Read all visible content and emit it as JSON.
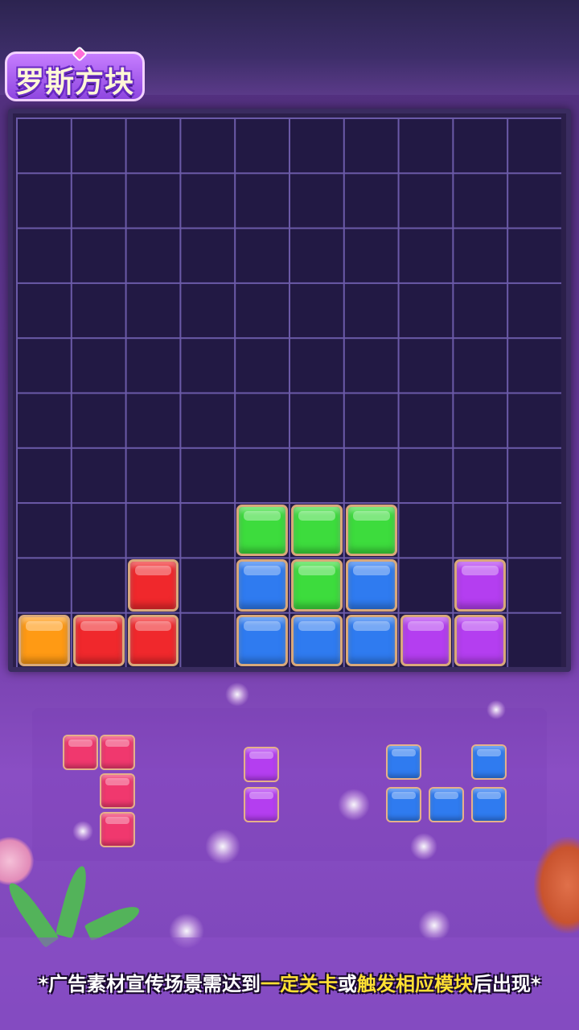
{
  "title": "罗斯方块",
  "board": {
    "columns": 10,
    "rows": 10,
    "filled_cells": [
      {
        "row": 7,
        "col": 4,
        "color": "green"
      },
      {
        "row": 7,
        "col": 5,
        "color": "green"
      },
      {
        "row": 7,
        "col": 6,
        "color": "green"
      },
      {
        "row": 8,
        "col": 2,
        "color": "red"
      },
      {
        "row": 8,
        "col": 4,
        "color": "blue"
      },
      {
        "row": 8,
        "col": 5,
        "color": "green"
      },
      {
        "row": 8,
        "col": 6,
        "color": "blue"
      },
      {
        "row": 8,
        "col": 8,
        "color": "purple"
      },
      {
        "row": 9,
        "col": 0,
        "color": "orange"
      },
      {
        "row": 9,
        "col": 1,
        "color": "red"
      },
      {
        "row": 9,
        "col": 2,
        "color": "red"
      },
      {
        "row": 9,
        "col": 4,
        "color": "blue"
      },
      {
        "row": 9,
        "col": 5,
        "color": "blue"
      },
      {
        "row": 9,
        "col": 6,
        "color": "blue"
      },
      {
        "row": 9,
        "col": 7,
        "color": "purple"
      },
      {
        "row": 9,
        "col": 8,
        "color": "purple"
      }
    ]
  },
  "pieces": [
    {
      "name": "piece-pink-j",
      "color": "pink",
      "cells": [
        [
          0,
          0
        ],
        [
          0,
          1
        ],
        [
          1,
          1
        ],
        [
          2,
          1
        ]
      ]
    },
    {
      "name": "piece-purple-bar",
      "color": "purple",
      "cells": [
        [
          0,
          0
        ],
        [
          1,
          0
        ]
      ]
    },
    {
      "name": "piece-blue-u",
      "color": "blue",
      "cells": [
        [
          0,
          0
        ],
        [
          0,
          2
        ],
        [
          1,
          0
        ],
        [
          1,
          1
        ],
        [
          1,
          2
        ]
      ]
    }
  ],
  "colors": {
    "green": "#3ddc3d",
    "red": "#f0282c",
    "blue": "#2f7bf0",
    "purple": "#b43ef0",
    "orange": "#ff9a14",
    "pink": "#f0386e"
  },
  "caption": {
    "part1": "*广告素材宣传场景需达到",
    "highlight1": "一定关卡",
    "part2": "或",
    "highlight2": "触发相应模块",
    "part3": "后出现*"
  }
}
